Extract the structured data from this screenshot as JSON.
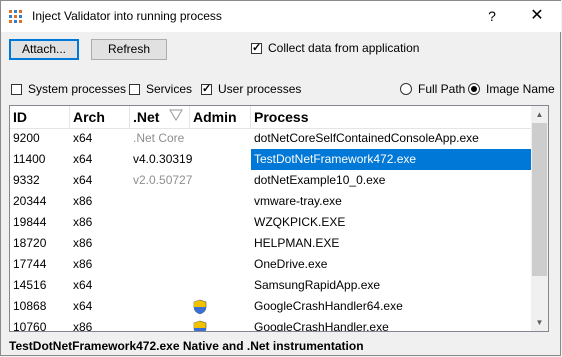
{
  "window": {
    "title": "Inject Validator into running process",
    "help_label": "?",
    "close_label": "✕"
  },
  "toolbar": {
    "attach_label": "Attach...",
    "refresh_label": "Refresh",
    "collect_label": "Collect data from application",
    "collect_checked": true
  },
  "filters": {
    "system_label": "System processes",
    "system_checked": false,
    "services_label": "Services",
    "services_checked": false,
    "user_label": "User processes",
    "user_checked": true,
    "fullpath_label": "Full Path",
    "imagename_label": "Image Name",
    "selected_display": "Image Name"
  },
  "table": {
    "columns": [
      "ID",
      "Arch",
      ".Net",
      "Admin",
      "Process"
    ],
    "rows": [
      {
        "id": "9200",
        "arch": "x64",
        "net": ".Net Core",
        "net_gray": true,
        "admin": false,
        "process": "dotNetCoreSelfContainedConsoleApp.exe"
      },
      {
        "id": "11400",
        "arch": "x64",
        "net": "v4.0.30319",
        "net_gray": false,
        "admin": false,
        "process": "TestDotNetFramework472.exe",
        "selected": true
      },
      {
        "id": "9332",
        "arch": "x64",
        "net": "v2.0.50727",
        "net_gray": true,
        "admin": false,
        "process": "dotNetExample10_0.exe"
      },
      {
        "id": "20344",
        "arch": "x86",
        "net": "",
        "admin": false,
        "process": "vmware-tray.exe"
      },
      {
        "id": "19844",
        "arch": "x86",
        "net": "",
        "admin": false,
        "process": "WZQKPICK.EXE"
      },
      {
        "id": "18720",
        "arch": "x86",
        "net": "",
        "admin": false,
        "process": "HELPMAN.EXE"
      },
      {
        "id": "17744",
        "arch": "x86",
        "net": "",
        "admin": false,
        "process": "OneDrive.exe"
      },
      {
        "id": "14516",
        "arch": "x64",
        "net": "",
        "admin": false,
        "process": "SamsungRapidApp.exe"
      },
      {
        "id": "10868",
        "arch": "x64",
        "net": "",
        "admin": true,
        "process": "GoogleCrashHandler64.exe"
      },
      {
        "id": "10760",
        "arch": "x86",
        "net": "",
        "admin": true,
        "process": "GoogleCrashHandler.exe"
      }
    ]
  },
  "status": {
    "text": "TestDotNetFramework472.exe Native and .Net instrumentation"
  },
  "colors": {
    "selection": "#0078d7",
    "accent": "#0078d7"
  }
}
